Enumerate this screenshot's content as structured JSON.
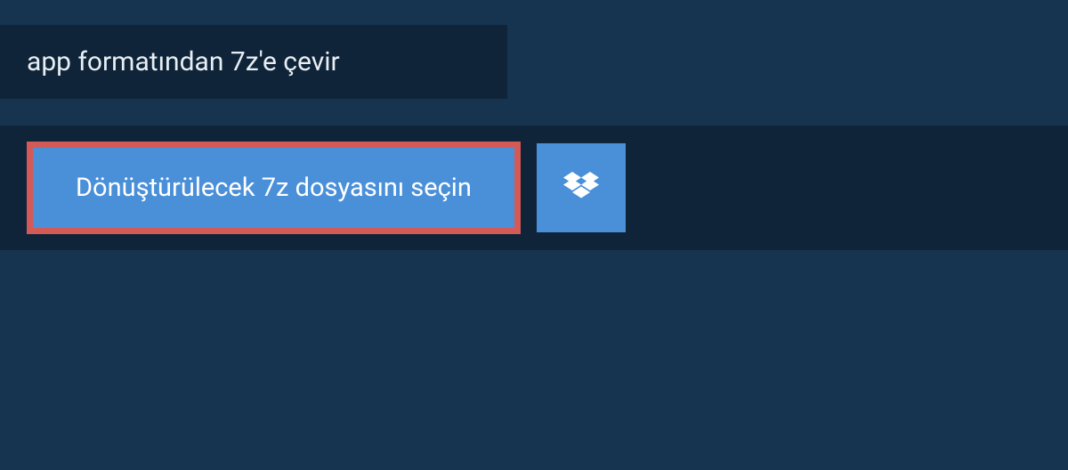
{
  "header": {
    "title": "app formatından 7z'e çevir"
  },
  "actions": {
    "select_file_label": "Dönüştürülecek 7z dosyasını seçin",
    "dropbox_icon": "dropbox-icon"
  },
  "colors": {
    "page_bg": "#163450",
    "panel_bg": "#0f2438",
    "button_bg": "#4a90d9",
    "button_border": "#d35a56",
    "text_light": "#e8eef4"
  }
}
